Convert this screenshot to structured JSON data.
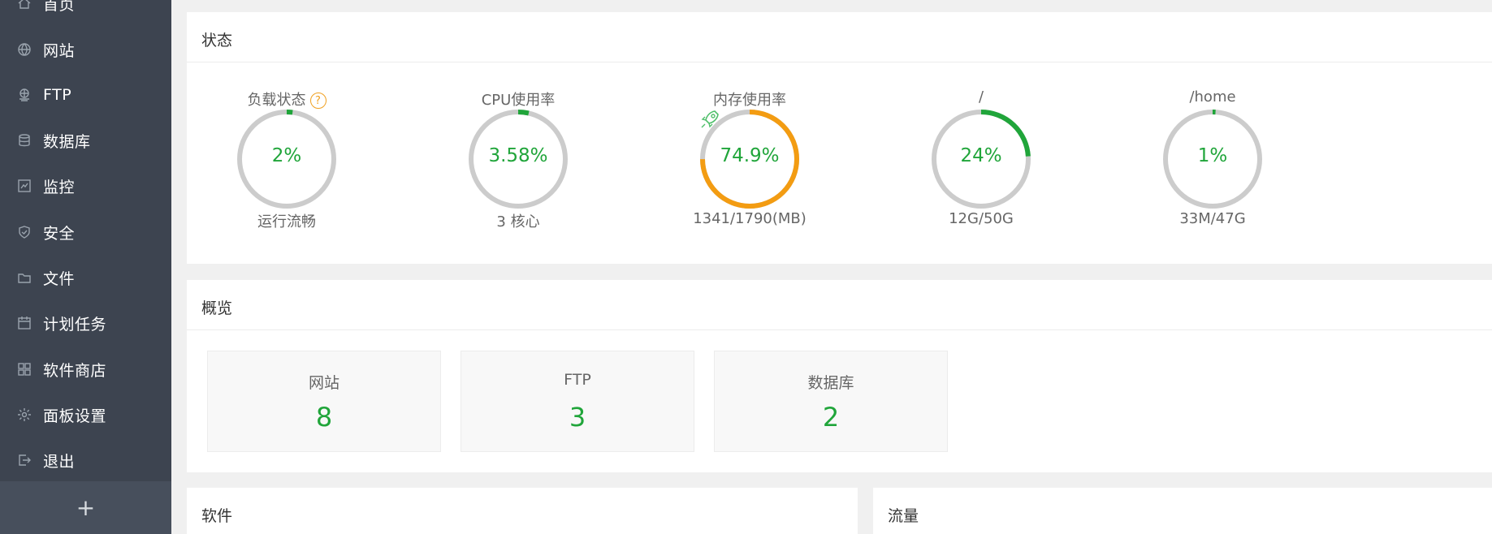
{
  "sidebar": {
    "items": [
      {
        "label": "首页",
        "icon": "home-icon"
      },
      {
        "label": "网站",
        "icon": "globe-icon"
      },
      {
        "label": "FTP",
        "icon": "ftp-icon"
      },
      {
        "label": "数据库",
        "icon": "database-icon"
      },
      {
        "label": "监控",
        "icon": "monitor-icon"
      },
      {
        "label": "安全",
        "icon": "shield-icon"
      },
      {
        "label": "文件",
        "icon": "folder-icon"
      },
      {
        "label": "计划任务",
        "icon": "calendar-icon"
      },
      {
        "label": "软件商店",
        "icon": "grid-icon"
      },
      {
        "label": "面板设置",
        "icon": "gear-icon"
      },
      {
        "label": "退出",
        "icon": "logout-icon"
      }
    ],
    "add_label": "+"
  },
  "status": {
    "title": "状态",
    "gauges": [
      {
        "label": "负载状态",
        "value_text": "2%",
        "percent": 2,
        "sub": "运行流畅",
        "color": "#20a53a",
        "has_help": true
      },
      {
        "label": "CPU使用率",
        "value_text": "3.58%",
        "percent": 3.58,
        "sub": "3 核心",
        "color": "#20a53a"
      },
      {
        "label": "内存使用率",
        "value_text": "74.9%",
        "percent": 74.9,
        "sub": "1341/1790(MB)",
        "color": "#f39c12",
        "has_rocket": true
      },
      {
        "label": "/",
        "value_text": "24%",
        "percent": 24,
        "sub": "12G/50G",
        "color": "#20a53a"
      },
      {
        "label": "/home",
        "value_text": "1%",
        "percent": 1,
        "sub": "33M/47G",
        "color": "#20a53a"
      }
    ],
    "help_symbol": "?"
  },
  "overview": {
    "title": "概览",
    "cards": [
      {
        "label": "网站",
        "value": "8"
      },
      {
        "label": "FTP",
        "value": "3"
      },
      {
        "label": "数据库",
        "value": "2"
      }
    ]
  },
  "software": {
    "title": "软件"
  },
  "traffic": {
    "title": "流量"
  },
  "colors": {
    "sidebar_bg": "#3d4450",
    "accent_green": "#20a53a",
    "accent_orange": "#f39c12",
    "gauge_track": "#cccccc"
  }
}
